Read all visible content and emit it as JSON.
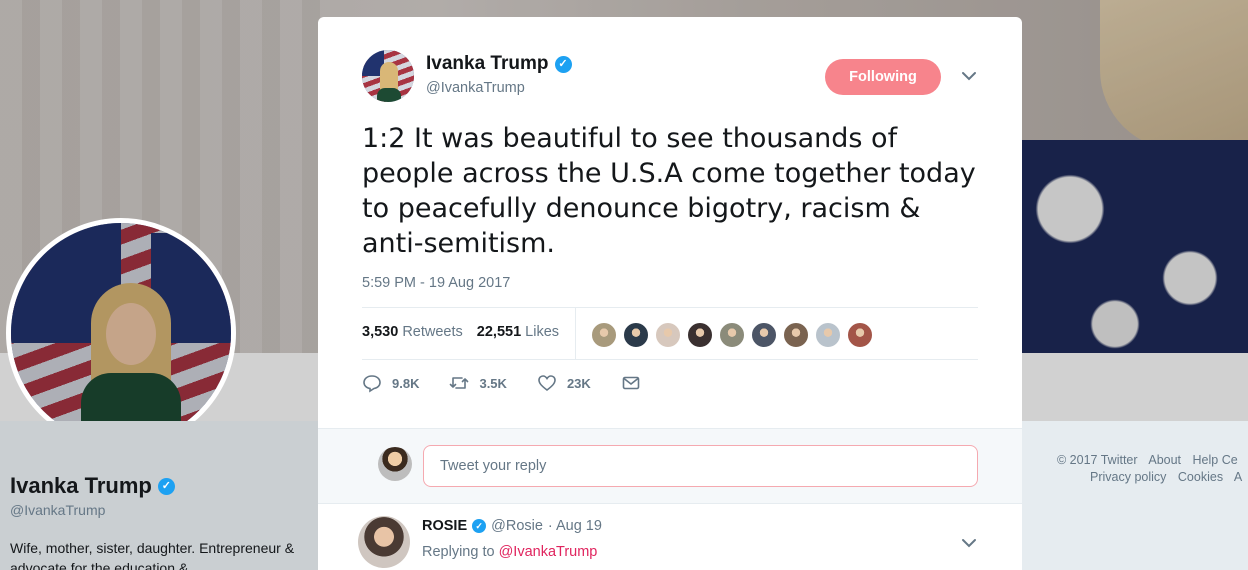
{
  "profile": {
    "name": "Ivanka Trump",
    "handle": "@IvankaTrump",
    "bio": "Wife, mother, sister, daughter. Entrepreneur & advocate for the education &"
  },
  "footer": {
    "copyright": "© 2017 Twitter",
    "about": "About",
    "help": "Help Ce",
    "privacy": "Privacy policy",
    "cookies": "Cookies",
    "ads": "A"
  },
  "tweet": {
    "author_name": "Ivanka Trump",
    "author_handle": "@IvankaTrump",
    "follow_label": "Following",
    "text": "1:2 It was beautiful to see thousands of people across the U.S.A come together today to peacefully denounce bigotry, racism & anti-semitism.",
    "timestamp": "5:59 PM - 19 Aug 2017",
    "retweets_count": "3,530",
    "retweets_label": "Retweets",
    "likes_count": "22,551",
    "likes_label": "Likes",
    "liker_colors": [
      "#a89a7c",
      "#2b3a4a",
      "#d7c8bd",
      "#3a3030",
      "#8b8b7a",
      "#4c5566",
      "#7a6350",
      "#b9c3cc",
      "#a35548"
    ],
    "actions": {
      "reply_count": "9.8K",
      "retweet_count": "3.5K",
      "like_count": "23K"
    },
    "reply_placeholder": "Tweet your reply",
    "accent_color": "#f7848c"
  },
  "reply": {
    "name": "ROSIE",
    "handle": "@Rosie",
    "date": "· Aug 19",
    "replying_prefix": "Replying to",
    "replying_to": "@IvankaTrump"
  }
}
